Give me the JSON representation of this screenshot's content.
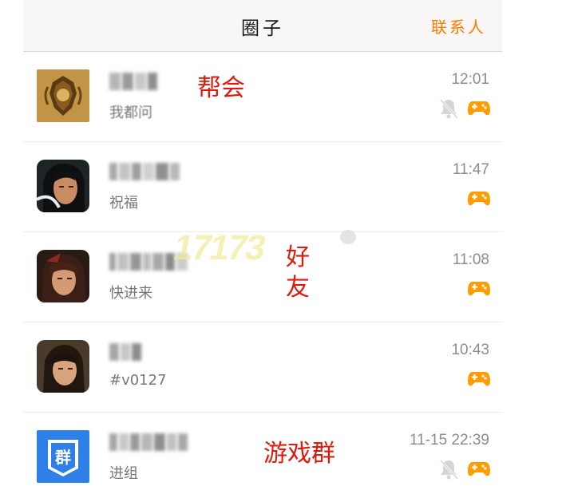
{
  "header": {
    "title": "圈子",
    "contacts_link": "联系人"
  },
  "rows": [
    {
      "subtitle": "我都问",
      "time": "12:01",
      "muted": true,
      "game_icon": "gamepad-icon",
      "avatar": "guild-crest"
    },
    {
      "subtitle": "祝福",
      "time": "11:47",
      "muted": false,
      "game_icon": "gamepad-icon",
      "avatar": "warrior-1"
    },
    {
      "subtitle": "快进来",
      "time": "11:08",
      "muted": false,
      "game_icon": "gamepad-icon",
      "avatar": "warrior-2"
    },
    {
      "subtitle": "#v0127",
      "time": "10:43",
      "muted": false,
      "game_icon": "gamepad-icon",
      "avatar": "warrior-3"
    },
    {
      "subtitle": "进组",
      "time": "11-15 22:39",
      "muted": true,
      "game_icon": "gamepad-icon",
      "avatar": "group-badge",
      "badge_text": "群"
    }
  ],
  "annotations": {
    "guild": "帮会",
    "friend_1": "好",
    "friend_2": "友",
    "group": "游戏群"
  },
  "watermark": "17173",
  "colors": {
    "accent": "#ff7a00",
    "game_icon": "#ff9d00",
    "annotation": "#e0190b",
    "group_badge": "#2f7fe9"
  }
}
